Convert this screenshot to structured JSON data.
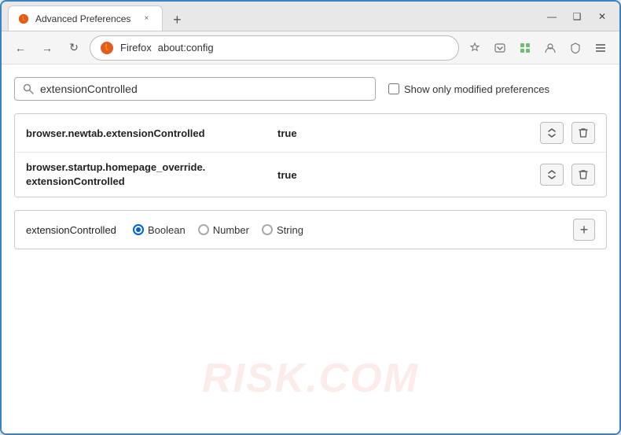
{
  "window": {
    "title": "Advanced Preferences",
    "tab_close": "×",
    "new_tab": "+",
    "minimize": "—",
    "maximize": "❑",
    "close": "✕"
  },
  "navbar": {
    "back": "←",
    "forward": "→",
    "refresh": "↻",
    "browser_name": "Firefox",
    "url": "about:config",
    "star": "☆",
    "pocket": "❤",
    "extension": "🧩",
    "profile": "👤",
    "shield": "🛡",
    "menu": "≡"
  },
  "search": {
    "placeholder": "extensionControlled",
    "value": "extensionControlled",
    "show_modified_label": "Show only modified preferences"
  },
  "results": [
    {
      "name": "browser.newtab.extensionControlled",
      "value": "true"
    },
    {
      "name_line1": "browser.startup.homepage_override.",
      "name_line2": "extensionControlled",
      "value": "true"
    }
  ],
  "add_pref": {
    "name": "extensionControlled",
    "type_boolean": "Boolean",
    "type_number": "Number",
    "type_string": "String",
    "add_button": "+"
  },
  "watermark": "RISK.COM"
}
